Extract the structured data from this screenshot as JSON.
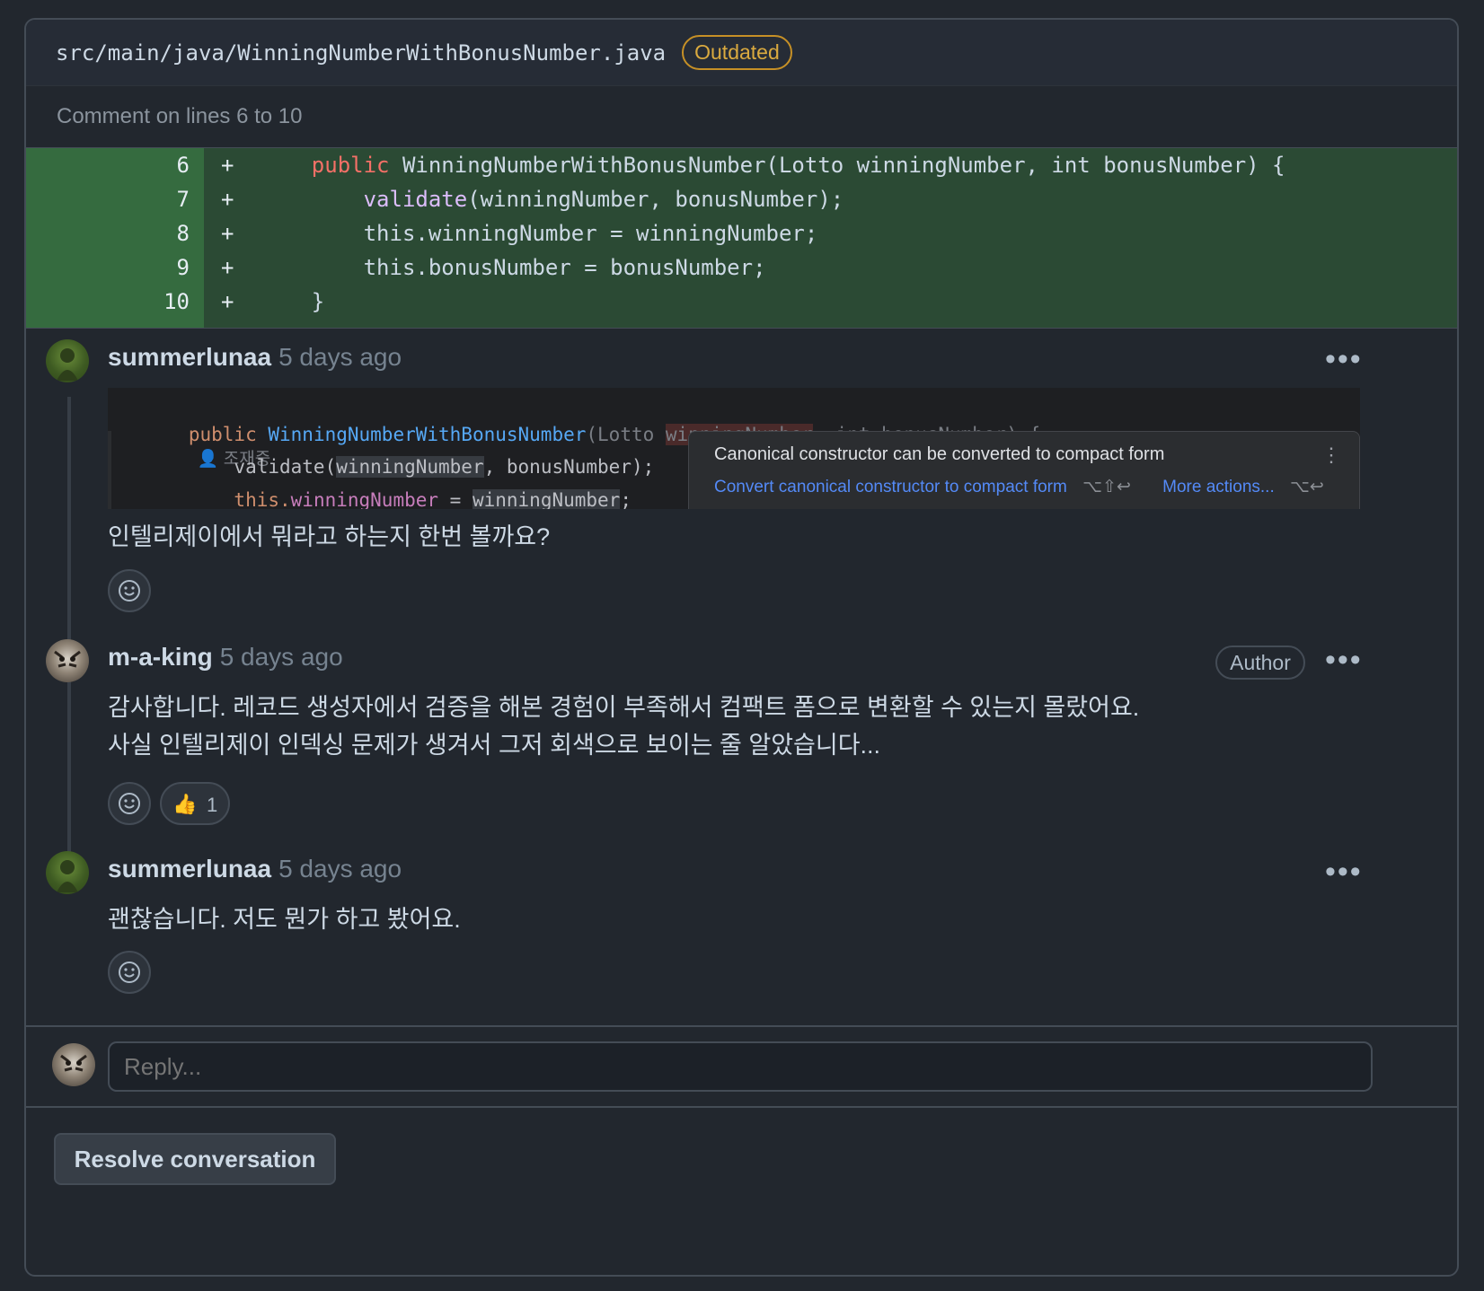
{
  "file": {
    "path": "src/main/java/WinningNumberWithBonusNumber.java",
    "badge": "Outdated",
    "comment_range": "Comment on lines 6 to 10"
  },
  "diff": {
    "lines": [
      {
        "num": "6",
        "sign": "+",
        "indent": "    ",
        "kw": "public",
        "rest": " WinningNumberWithBonusNumber(Lotto winningNumber, int bonusNumber) {"
      },
      {
        "num": "7",
        "sign": "+",
        "indent": "        ",
        "fn": "validate",
        "rest": "(winningNumber, bonusNumber);"
      },
      {
        "num": "8",
        "sign": "+",
        "indent": "        ",
        "rest": "this.winningNumber = winningNumber;"
      },
      {
        "num": "9",
        "sign": "+",
        "indent": "        ",
        "rest": "this.bonusNumber = bonusNumber;"
      },
      {
        "num": "10",
        "sign": "+",
        "indent": "    ",
        "rest": "}"
      }
    ]
  },
  "comments": [
    {
      "author": "summerlunaa",
      "time": "5 days ago",
      "body": "인텔리제이에서 뭐라고 하는지 한번 볼까요?",
      "avatar": "green-avatar"
    },
    {
      "author": "m-a-king",
      "time": "5 days ago",
      "badge": "Author",
      "body_line1": "감사합니다. 레코드 생성자에서 검증을 해본 경험이 부족해서 컴팩트 폼으로 변환할 수 있는지 몰랐어요.",
      "body_line2": "사실 인텔리제이 인덱싱 문제가 생겨서 그저 회색으로 보이는 줄 알았습니다...",
      "reaction_emoji": "👍",
      "reaction_count": "1",
      "avatar": "tiger-avatar"
    },
    {
      "author": "summerlunaa",
      "time": "5 days ago",
      "body": "괜찮습니다. 저도 뭔가 하고 봤어요.",
      "avatar": "green-avatar"
    }
  ],
  "ide_screenshot": {
    "line1_kw": "public",
    "line1_class": "WinningNumberWithBonusNumber",
    "line1_params_a": "(Lotto ",
    "line1_param_hl": "winningNumber",
    "line1_params_b": ", int bonusNumber) {",
    "line1_user": "조재중",
    "line2_a": "    validate(",
    "line2_hl": "winningNumber",
    "line2_b": ", bonusNumber);",
    "line3_this": "    this.",
    "line3_field": "winningNumber",
    "line3_eq": " = ",
    "line3_hl": "winningNumber",
    "line3_end": ";",
    "popup_title": "Canonical constructor can be converted to compact form",
    "popup_action": "Convert canonical constructor to compact form",
    "popup_action_shortcut": "⌥⇧↩",
    "popup_more": "More actions...",
    "popup_more_shortcut": "⌥↩"
  },
  "reply": {
    "placeholder": "Reply..."
  },
  "resolve_label": "Resolve conversation",
  "colors": {
    "background": "#22272e",
    "outdated": "#daaa3f",
    "diff_added": "#2b4a34",
    "link": "#548af7"
  }
}
